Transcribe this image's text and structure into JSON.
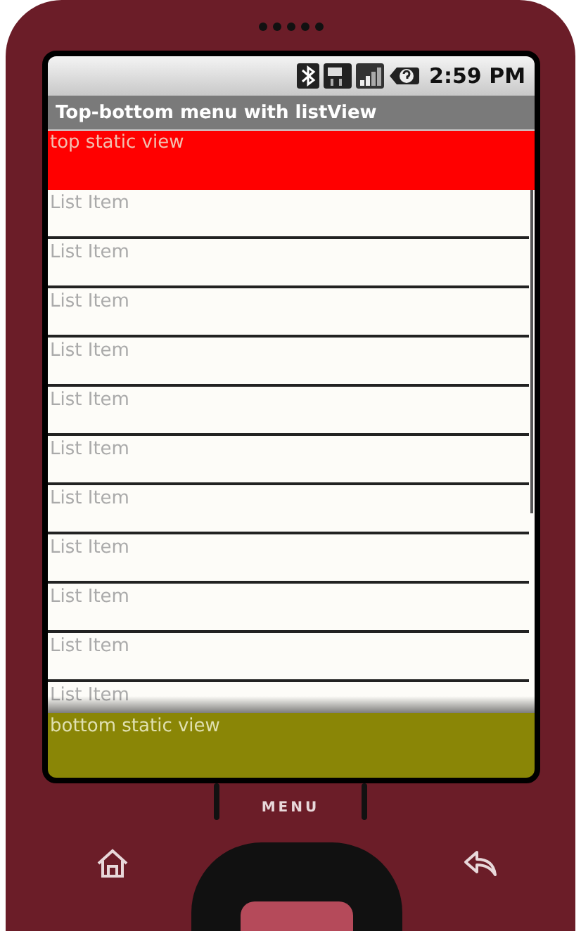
{
  "status_bar": {
    "time": "2:59 PM"
  },
  "title_bar": {
    "title": "Top-bottom menu with listView"
  },
  "top_view": {
    "text": "top static view"
  },
  "list": {
    "items": [
      {
        "label": "List Item"
      },
      {
        "label": "List Item"
      },
      {
        "label": "List Item"
      },
      {
        "label": "List Item"
      },
      {
        "label": "List Item"
      },
      {
        "label": "List Item"
      },
      {
        "label": "List Item"
      },
      {
        "label": "List Item"
      },
      {
        "label": "List Item"
      },
      {
        "label": "List Item"
      },
      {
        "label": "List Item"
      }
    ]
  },
  "bottom_view": {
    "text": "bottom static view"
  },
  "hardware_keys": {
    "menu": "MENU"
  }
}
